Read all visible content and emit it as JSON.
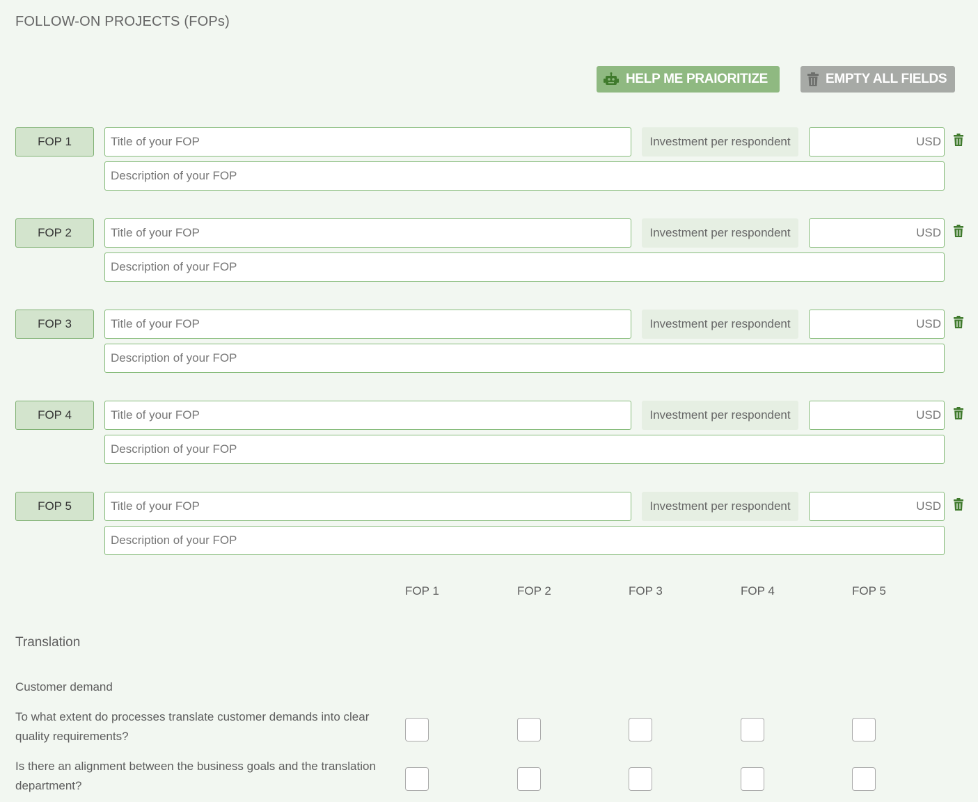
{
  "page_title": "FOLLOW-ON PROJECTS (FOPs)",
  "toolbar": {
    "help_label": "HELP ME PRAIORITIZE",
    "empty_label": "EMPTY ALL FIELDS"
  },
  "colors": {
    "accent": "#8fb981",
    "label_bg": "#d3e4cd",
    "border": "#86bb7a",
    "trash_icon": "#3f7a2c",
    "button_grey": "#a7aaa6"
  },
  "fops": [
    {
      "label": "FOP 1",
      "title_placeholder": "Title of your FOP",
      "title_value": "",
      "investment_label": "Investment per respondent",
      "amount_value": "",
      "currency": "USD",
      "description_placeholder": "Description of your FOP",
      "description_value": ""
    },
    {
      "label": "FOP 2",
      "title_placeholder": "Title of your FOP",
      "title_value": "",
      "investment_label": "Investment per respondent",
      "amount_value": "",
      "currency": "USD",
      "description_placeholder": "Description of your FOP",
      "description_value": ""
    },
    {
      "label": "FOP 3",
      "title_placeholder": "Title of your FOP",
      "title_value": "",
      "investment_label": "Investment per respondent",
      "amount_value": "",
      "currency": "USD",
      "description_placeholder": "Description of your FOP",
      "description_value": ""
    },
    {
      "label": "FOP 4",
      "title_placeholder": "Title of your FOP",
      "title_value": "",
      "investment_label": "Investment per respondent",
      "amount_value": "",
      "currency": "USD",
      "description_placeholder": "Description of your FOP",
      "description_value": ""
    },
    {
      "label": "FOP 5",
      "title_placeholder": "Title of your FOP",
      "title_value": "",
      "investment_label": "Investment per respondent",
      "amount_value": "",
      "currency": "USD",
      "description_placeholder": "Description of your FOP",
      "description_value": ""
    }
  ],
  "matrix": {
    "columns": [
      "FOP 1",
      "FOP 2",
      "FOP 3",
      "FOP 4",
      "FOP 5"
    ],
    "section_title": "Translation",
    "subsection_title": "Customer demand",
    "questions": [
      {
        "text": "To what extent do processes translate customer demands into clear quality requirements?",
        "checked": [
          false,
          false,
          false,
          false,
          false
        ]
      },
      {
        "text": "Is there an alignment between the business goals and the translation department?",
        "checked": [
          false,
          false,
          false,
          false,
          false
        ]
      }
    ]
  },
  "icons": {
    "help_button": "robot-icon",
    "empty_button": "trash-icon",
    "row_delete": "trash-icon"
  }
}
